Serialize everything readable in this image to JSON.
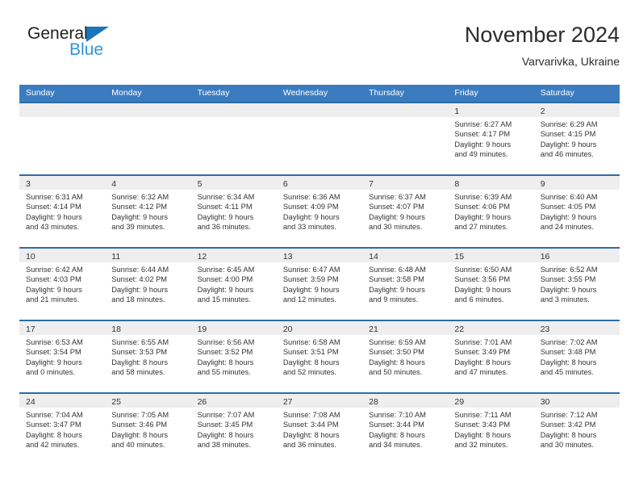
{
  "logo": {
    "word_one": "General",
    "word_two": "Blue",
    "triangle_color": "#1b75bb",
    "blue_text_color": "#2e96d8"
  },
  "header": {
    "title": "November 2024",
    "subtitle": "Varvarivka, Ukraine"
  },
  "theme": {
    "header_blue": "#3b7cc0",
    "cell_rule": "#2e6da4",
    "date_band": "#eeeeee",
    "text": "#333333"
  },
  "calendar": {
    "weekdays": [
      "Sunday",
      "Monday",
      "Tuesday",
      "Wednesday",
      "Thursday",
      "Friday",
      "Saturday"
    ],
    "weeks": [
      [
        {
          "date": "",
          "lines": []
        },
        {
          "date": "",
          "lines": []
        },
        {
          "date": "",
          "lines": []
        },
        {
          "date": "",
          "lines": []
        },
        {
          "date": "",
          "lines": []
        },
        {
          "date": "1",
          "lines": [
            "Sunrise: 6:27 AM",
            "Sunset: 4:17 PM",
            "Daylight: 9 hours",
            "and 49 minutes."
          ]
        },
        {
          "date": "2",
          "lines": [
            "Sunrise: 6:29 AM",
            "Sunset: 4:15 PM",
            "Daylight: 9 hours",
            "and 46 minutes."
          ]
        }
      ],
      [
        {
          "date": "3",
          "lines": [
            "Sunrise: 6:31 AM",
            "Sunset: 4:14 PM",
            "Daylight: 9 hours",
            "and 43 minutes."
          ]
        },
        {
          "date": "4",
          "lines": [
            "Sunrise: 6:32 AM",
            "Sunset: 4:12 PM",
            "Daylight: 9 hours",
            "and 39 minutes."
          ]
        },
        {
          "date": "5",
          "lines": [
            "Sunrise: 6:34 AM",
            "Sunset: 4:11 PM",
            "Daylight: 9 hours",
            "and 36 minutes."
          ]
        },
        {
          "date": "6",
          "lines": [
            "Sunrise: 6:36 AM",
            "Sunset: 4:09 PM",
            "Daylight: 9 hours",
            "and 33 minutes."
          ]
        },
        {
          "date": "7",
          "lines": [
            "Sunrise: 6:37 AM",
            "Sunset: 4:07 PM",
            "Daylight: 9 hours",
            "and 30 minutes."
          ]
        },
        {
          "date": "8",
          "lines": [
            "Sunrise: 6:39 AM",
            "Sunset: 4:06 PM",
            "Daylight: 9 hours",
            "and 27 minutes."
          ]
        },
        {
          "date": "9",
          "lines": [
            "Sunrise: 6:40 AM",
            "Sunset: 4:05 PM",
            "Daylight: 9 hours",
            "and 24 minutes."
          ]
        }
      ],
      [
        {
          "date": "10",
          "lines": [
            "Sunrise: 6:42 AM",
            "Sunset: 4:03 PM",
            "Daylight: 9 hours",
            "and 21 minutes."
          ]
        },
        {
          "date": "11",
          "lines": [
            "Sunrise: 6:44 AM",
            "Sunset: 4:02 PM",
            "Daylight: 9 hours",
            "and 18 minutes."
          ]
        },
        {
          "date": "12",
          "lines": [
            "Sunrise: 6:45 AM",
            "Sunset: 4:00 PM",
            "Daylight: 9 hours",
            "and 15 minutes."
          ]
        },
        {
          "date": "13",
          "lines": [
            "Sunrise: 6:47 AM",
            "Sunset: 3:59 PM",
            "Daylight: 9 hours",
            "and 12 minutes."
          ]
        },
        {
          "date": "14",
          "lines": [
            "Sunrise: 6:48 AM",
            "Sunset: 3:58 PM",
            "Daylight: 9 hours",
            "and 9 minutes."
          ]
        },
        {
          "date": "15",
          "lines": [
            "Sunrise: 6:50 AM",
            "Sunset: 3:56 PM",
            "Daylight: 9 hours",
            "and 6 minutes."
          ]
        },
        {
          "date": "16",
          "lines": [
            "Sunrise: 6:52 AM",
            "Sunset: 3:55 PM",
            "Daylight: 9 hours",
            "and 3 minutes."
          ]
        }
      ],
      [
        {
          "date": "17",
          "lines": [
            "Sunrise: 6:53 AM",
            "Sunset: 3:54 PM",
            "Daylight: 9 hours",
            "and 0 minutes."
          ]
        },
        {
          "date": "18",
          "lines": [
            "Sunrise: 6:55 AM",
            "Sunset: 3:53 PM",
            "Daylight: 8 hours",
            "and 58 minutes."
          ]
        },
        {
          "date": "19",
          "lines": [
            "Sunrise: 6:56 AM",
            "Sunset: 3:52 PM",
            "Daylight: 8 hours",
            "and 55 minutes."
          ]
        },
        {
          "date": "20",
          "lines": [
            "Sunrise: 6:58 AM",
            "Sunset: 3:51 PM",
            "Daylight: 8 hours",
            "and 52 minutes."
          ]
        },
        {
          "date": "21",
          "lines": [
            "Sunrise: 6:59 AM",
            "Sunset: 3:50 PM",
            "Daylight: 8 hours",
            "and 50 minutes."
          ]
        },
        {
          "date": "22",
          "lines": [
            "Sunrise: 7:01 AM",
            "Sunset: 3:49 PM",
            "Daylight: 8 hours",
            "and 47 minutes."
          ]
        },
        {
          "date": "23",
          "lines": [
            "Sunrise: 7:02 AM",
            "Sunset: 3:48 PM",
            "Daylight: 8 hours",
            "and 45 minutes."
          ]
        }
      ],
      [
        {
          "date": "24",
          "lines": [
            "Sunrise: 7:04 AM",
            "Sunset: 3:47 PM",
            "Daylight: 8 hours",
            "and 42 minutes."
          ]
        },
        {
          "date": "25",
          "lines": [
            "Sunrise: 7:05 AM",
            "Sunset: 3:46 PM",
            "Daylight: 8 hours",
            "and 40 minutes."
          ]
        },
        {
          "date": "26",
          "lines": [
            "Sunrise: 7:07 AM",
            "Sunset: 3:45 PM",
            "Daylight: 8 hours",
            "and 38 minutes."
          ]
        },
        {
          "date": "27",
          "lines": [
            "Sunrise: 7:08 AM",
            "Sunset: 3:44 PM",
            "Daylight: 8 hours",
            "and 36 minutes."
          ]
        },
        {
          "date": "28",
          "lines": [
            "Sunrise: 7:10 AM",
            "Sunset: 3:44 PM",
            "Daylight: 8 hours",
            "and 34 minutes."
          ]
        },
        {
          "date": "29",
          "lines": [
            "Sunrise: 7:11 AM",
            "Sunset: 3:43 PM",
            "Daylight: 8 hours",
            "and 32 minutes."
          ]
        },
        {
          "date": "30",
          "lines": [
            "Sunrise: 7:12 AM",
            "Sunset: 3:42 PM",
            "Daylight: 8 hours",
            "and 30 minutes."
          ]
        }
      ]
    ]
  }
}
